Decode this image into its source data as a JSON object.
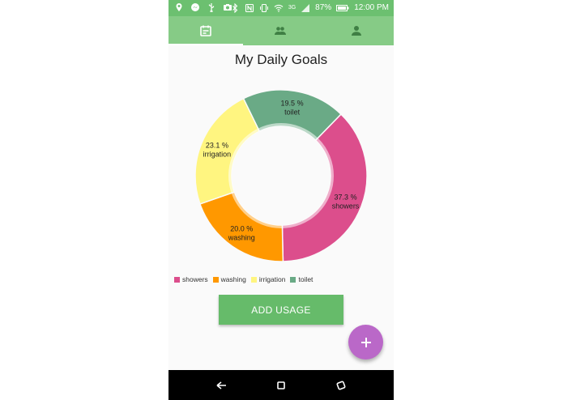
{
  "status_bar": {
    "battery_percent": "87%",
    "time": "12:00 PM",
    "network": "3G",
    "icons_left": [
      "location-icon",
      "messenger-icon",
      "usb-icon",
      "camera-icon"
    ],
    "icons_right": [
      "bluetooth-icon",
      "nfc-icon",
      "vibrate-icon",
      "wifi-icon",
      "signal-icon",
      "battery-icon"
    ]
  },
  "tabs": [
    {
      "icon": "calendar-icon",
      "selected": true
    },
    {
      "icon": "group-icon",
      "selected": false
    },
    {
      "icon": "person-icon",
      "selected": false
    }
  ],
  "main": {
    "title": "My Daily Goals",
    "add_button_label": "ADD USAGE",
    "fab_icon": "plus-icon"
  },
  "chart_data": {
    "type": "pie",
    "donut": true,
    "categories": [
      "showers",
      "washing",
      "irrigation",
      "toilet"
    ],
    "values": [
      37.3,
      20.0,
      23.1,
      19.5
    ],
    "labels": [
      "37.3 %",
      "20.0 %",
      "23.1 %",
      "19.5 %"
    ],
    "colors": [
      "#dc4e8c",
      "#ff9800",
      "#fff580",
      "#6aaa86"
    ],
    "legend": "bottom-left"
  },
  "colors": {
    "accent_green": "#66bb6a",
    "tab_bar": "#86cb86",
    "fab": "#ba68c8"
  },
  "nav_bar": {
    "buttons": [
      "back-icon",
      "home-icon",
      "recents-icon"
    ]
  }
}
